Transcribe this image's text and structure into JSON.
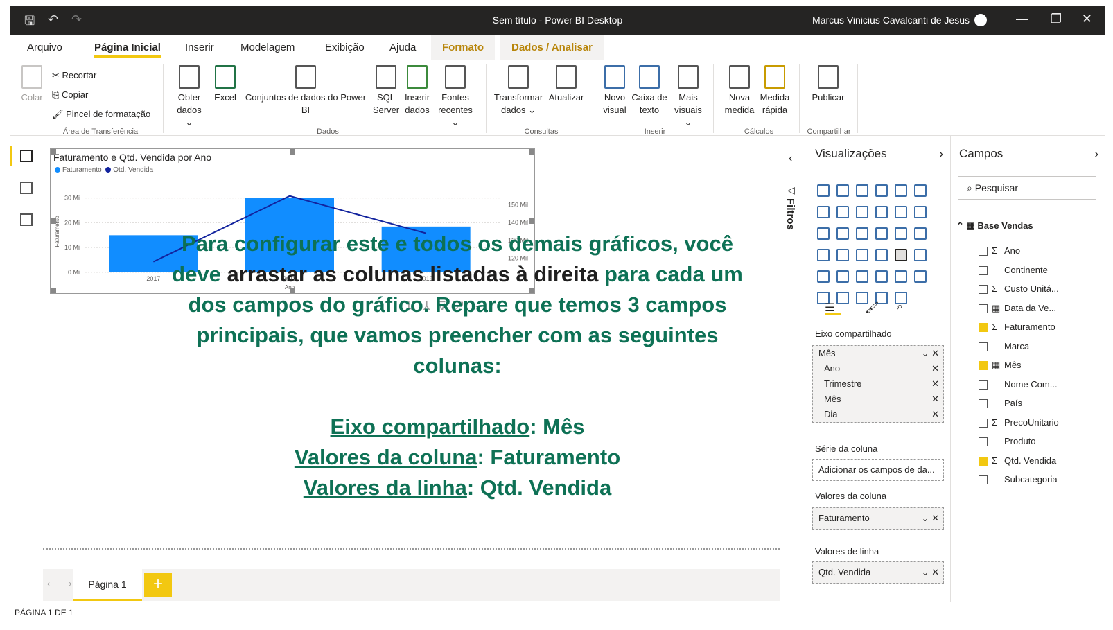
{
  "window": {
    "title": "Sem título - Power BI Desktop",
    "user": "Marcus Vinicius Cavalcanti de Jesus"
  },
  "tabs": [
    "Arquivo",
    "Página Inicial",
    "Inserir",
    "Modelagem",
    "Exibição",
    "Ajuda",
    "Formato",
    "Dados / Analisar"
  ],
  "ribbon": {
    "colar": "Colar",
    "recortar": "Recortar",
    "copiar": "Copiar",
    "pincel": "Pincel de formatação",
    "grp_area": "Área de Transferência",
    "obter": "Obter dados",
    "excel": "Excel",
    "conjuntos": "Conjuntos de dados do Power BI",
    "sql": "SQL Server",
    "inserir_dados": "Inserir dados",
    "fontes": "Fontes recentes",
    "grp_dados": "Dados",
    "transformar": "Transformar dados",
    "atualizar": "Atualizar",
    "grp_consultas": "Consultas",
    "novo_visual": "Novo visual",
    "caixa_texto": "Caixa de texto",
    "mais_visuais": "Mais visuais",
    "grp_inserir": "Inserir",
    "nova_medida": "Nova medida",
    "medida_rapida": "Medida rápida",
    "grp_calculos": "Cálculos",
    "publicar": "Publicar",
    "grp_compartilhar": "Compartilhar"
  },
  "chart_data": {
    "type": "bar",
    "title": "Faturamento e Qtd. Vendida por Ano",
    "categories": [
      "2017",
      "2018",
      "2019"
    ],
    "series": [
      {
        "name": "Faturamento",
        "values": [
          15,
          30,
          18.5
        ],
        "color": "#118dff",
        "axis": "left"
      },
      {
        "name": "Qtd. Vendida",
        "values": [
          118,
          155,
          134
        ],
        "color": "#12239e",
        "axis": "right",
        "kind": "line"
      }
    ],
    "ylabel": "Faturamento",
    "xlabel": "Ano",
    "left_ticks": [
      "0 Mi",
      "10 Mi",
      "20 Mi",
      "30 Mi"
    ],
    "right_ticks": [
      "120 Mil",
      "130 Mil",
      "140 Mil",
      "150 Mil"
    ],
    "ylim": [
      0,
      33
    ],
    "y2lim": [
      112,
      158
    ]
  },
  "overlay": {
    "p1a": "Para configurar este e todos os demais gráficos, você deve ",
    "p1b": "arrastar as colunas listadas à direita",
    "p1c": " para cada um dos campos do gráfico. Repare que temos 3 campos principais, que vamos preencher com as seguintes colunas:",
    "l1a": "Eixo compartilhado",
    "l1b": ": Mês",
    "l2a": "Valores da coluna",
    "l2b": ": Faturamento",
    "l3a": "Valores da linha",
    "l3b": ": Qtd. Vendida"
  },
  "page": {
    "tab": "Página 1",
    "add": "+",
    "status": "PÁGINA 1 DE 1"
  },
  "filters": {
    "label": "Filtros"
  },
  "viz": {
    "title": "Visualizações",
    "eixo_label": "Eixo compartilhado",
    "eixo_items": [
      "Mês",
      "Ano",
      "Trimestre",
      "Mês",
      "Dia"
    ],
    "serie_label": "Série da coluna",
    "serie_placeholder": "Adicionar os campos de da...",
    "valores_col_label": "Valores da coluna",
    "valores_col": "Faturamento",
    "valores_lin_label": "Valores de linha",
    "valores_lin": "Qtd. Vendida"
  },
  "campos": {
    "title": "Campos",
    "search_placeholder": "Pesquisar",
    "table": "Base Vendas",
    "fields": [
      {
        "name": "Ano",
        "sigma": "Σ",
        "checked": false
      },
      {
        "name": "Continente",
        "sigma": "",
        "checked": false
      },
      {
        "name": "Custo Unitá...",
        "sigma": "Σ",
        "checked": false
      },
      {
        "name": "Data da Ve...",
        "sigma": "▦",
        "checked": false
      },
      {
        "name": "Faturamento",
        "sigma": "Σ",
        "checked": true
      },
      {
        "name": "Marca",
        "sigma": "",
        "checked": false
      },
      {
        "name": "Mês",
        "sigma": "▦",
        "checked": true
      },
      {
        "name": "Nome Com...",
        "sigma": "",
        "checked": false
      },
      {
        "name": "País",
        "sigma": "",
        "checked": false
      },
      {
        "name": "PrecoUnitario",
        "sigma": "Σ",
        "checked": false
      },
      {
        "name": "Produto",
        "sigma": "",
        "checked": false
      },
      {
        "name": "Qtd. Vendida",
        "sigma": "Σ",
        "checked": true
      },
      {
        "name": "Subcategoria",
        "sigma": "",
        "checked": false
      }
    ]
  }
}
